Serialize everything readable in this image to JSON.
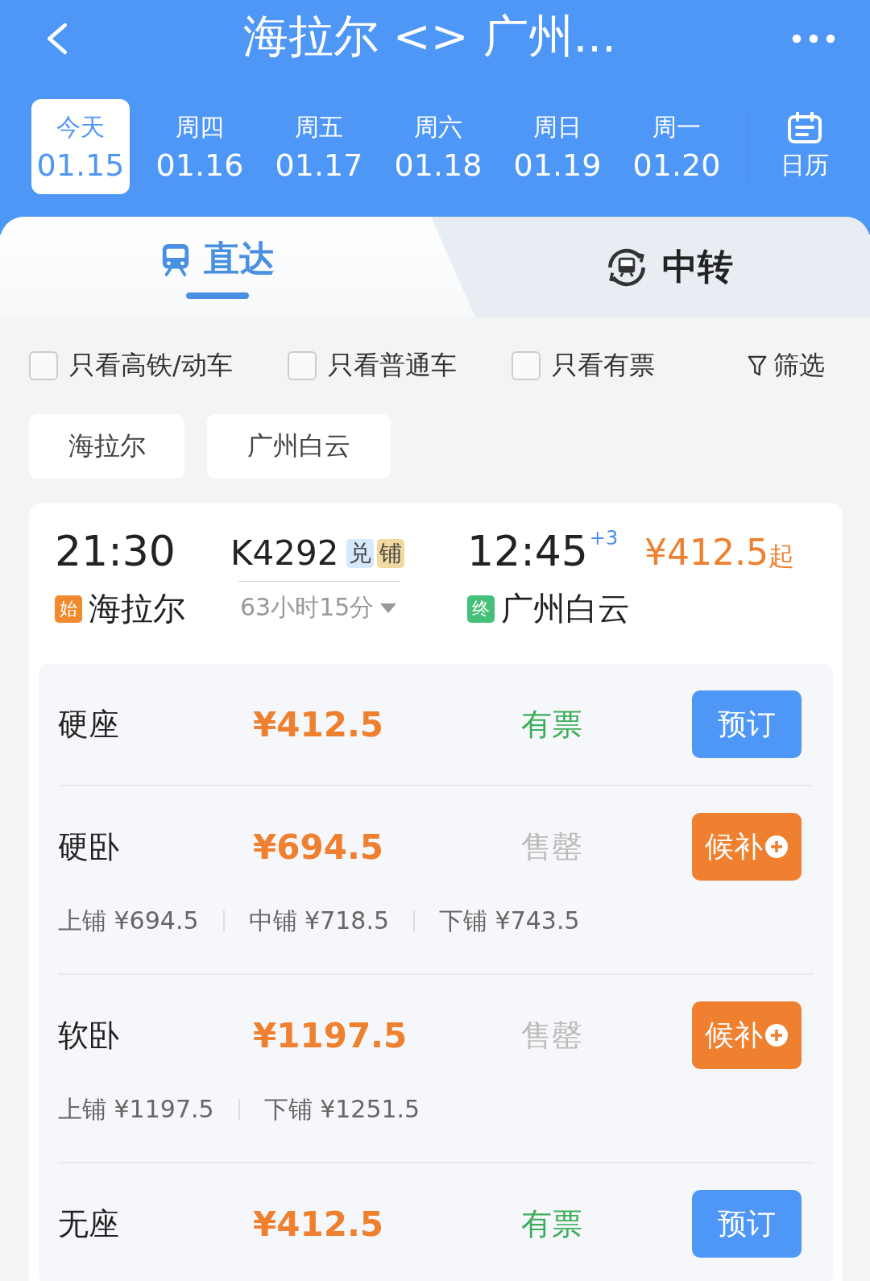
{
  "header": {
    "title": "海拉尔 <> 广州..."
  },
  "dates": [
    {
      "weekday": "今天",
      "date": "01.15",
      "selected": true
    },
    {
      "weekday": "周四",
      "date": "01.16",
      "selected": false
    },
    {
      "weekday": "周五",
      "date": "01.17",
      "selected": false
    },
    {
      "weekday": "周六",
      "date": "01.18",
      "selected": false
    },
    {
      "weekday": "周日",
      "date": "01.19",
      "selected": false
    },
    {
      "weekday": "周一",
      "date": "01.20",
      "selected": false
    }
  ],
  "calendar": {
    "label": "日历"
  },
  "tabs": [
    {
      "label": "直达",
      "selected": true,
      "kind": "direct"
    },
    {
      "label": "中转",
      "selected": false,
      "kind": "transfer"
    }
  ],
  "filters": [
    {
      "label": "只看高铁/动车",
      "checked": false
    },
    {
      "label": "只看普通车",
      "checked": false
    },
    {
      "label": "只看有票",
      "checked": false
    }
  ],
  "filter_button": {
    "label": "筛选"
  },
  "stations": [
    "海拉尔",
    "广州白云"
  ],
  "train": {
    "depart_time": "21:30",
    "depart_tag": "始",
    "depart_station": "海拉尔",
    "train_no": "K4292",
    "badges": [
      {
        "label": "兑",
        "color": "#d6e8fb"
      },
      {
        "label": "铺",
        "color": "#f2d9a0"
      }
    ],
    "duration": "63小时15分",
    "arrive_time": "12:45",
    "day_offset": "+3",
    "arrive_tag": "终",
    "arrive_station": "广州白云",
    "price": "¥412.5",
    "price_suffix": "起"
  },
  "seats": [
    {
      "name": "硬座",
      "price": "¥412.5",
      "status": "有票",
      "available": true,
      "button": {
        "label": "预订",
        "kind": "book"
      }
    },
    {
      "name": "硬卧",
      "price": "¥694.5",
      "status": "售罄",
      "available": false,
      "button": {
        "label": "候补",
        "kind": "waitlist"
      },
      "berths": [
        "上铺 ¥694.5",
        "中铺 ¥718.5",
        "下铺 ¥743.5"
      ]
    },
    {
      "name": "软卧",
      "price": "¥1197.5",
      "status": "售罄",
      "available": false,
      "button": {
        "label": "候补",
        "kind": "waitlist"
      },
      "berths": [
        "上铺 ¥1197.5",
        "下铺 ¥1251.5"
      ]
    },
    {
      "name": "无座",
      "price": "¥412.5",
      "status": "有票",
      "available": true,
      "button": {
        "label": "预订",
        "kind": "book"
      }
    }
  ]
}
